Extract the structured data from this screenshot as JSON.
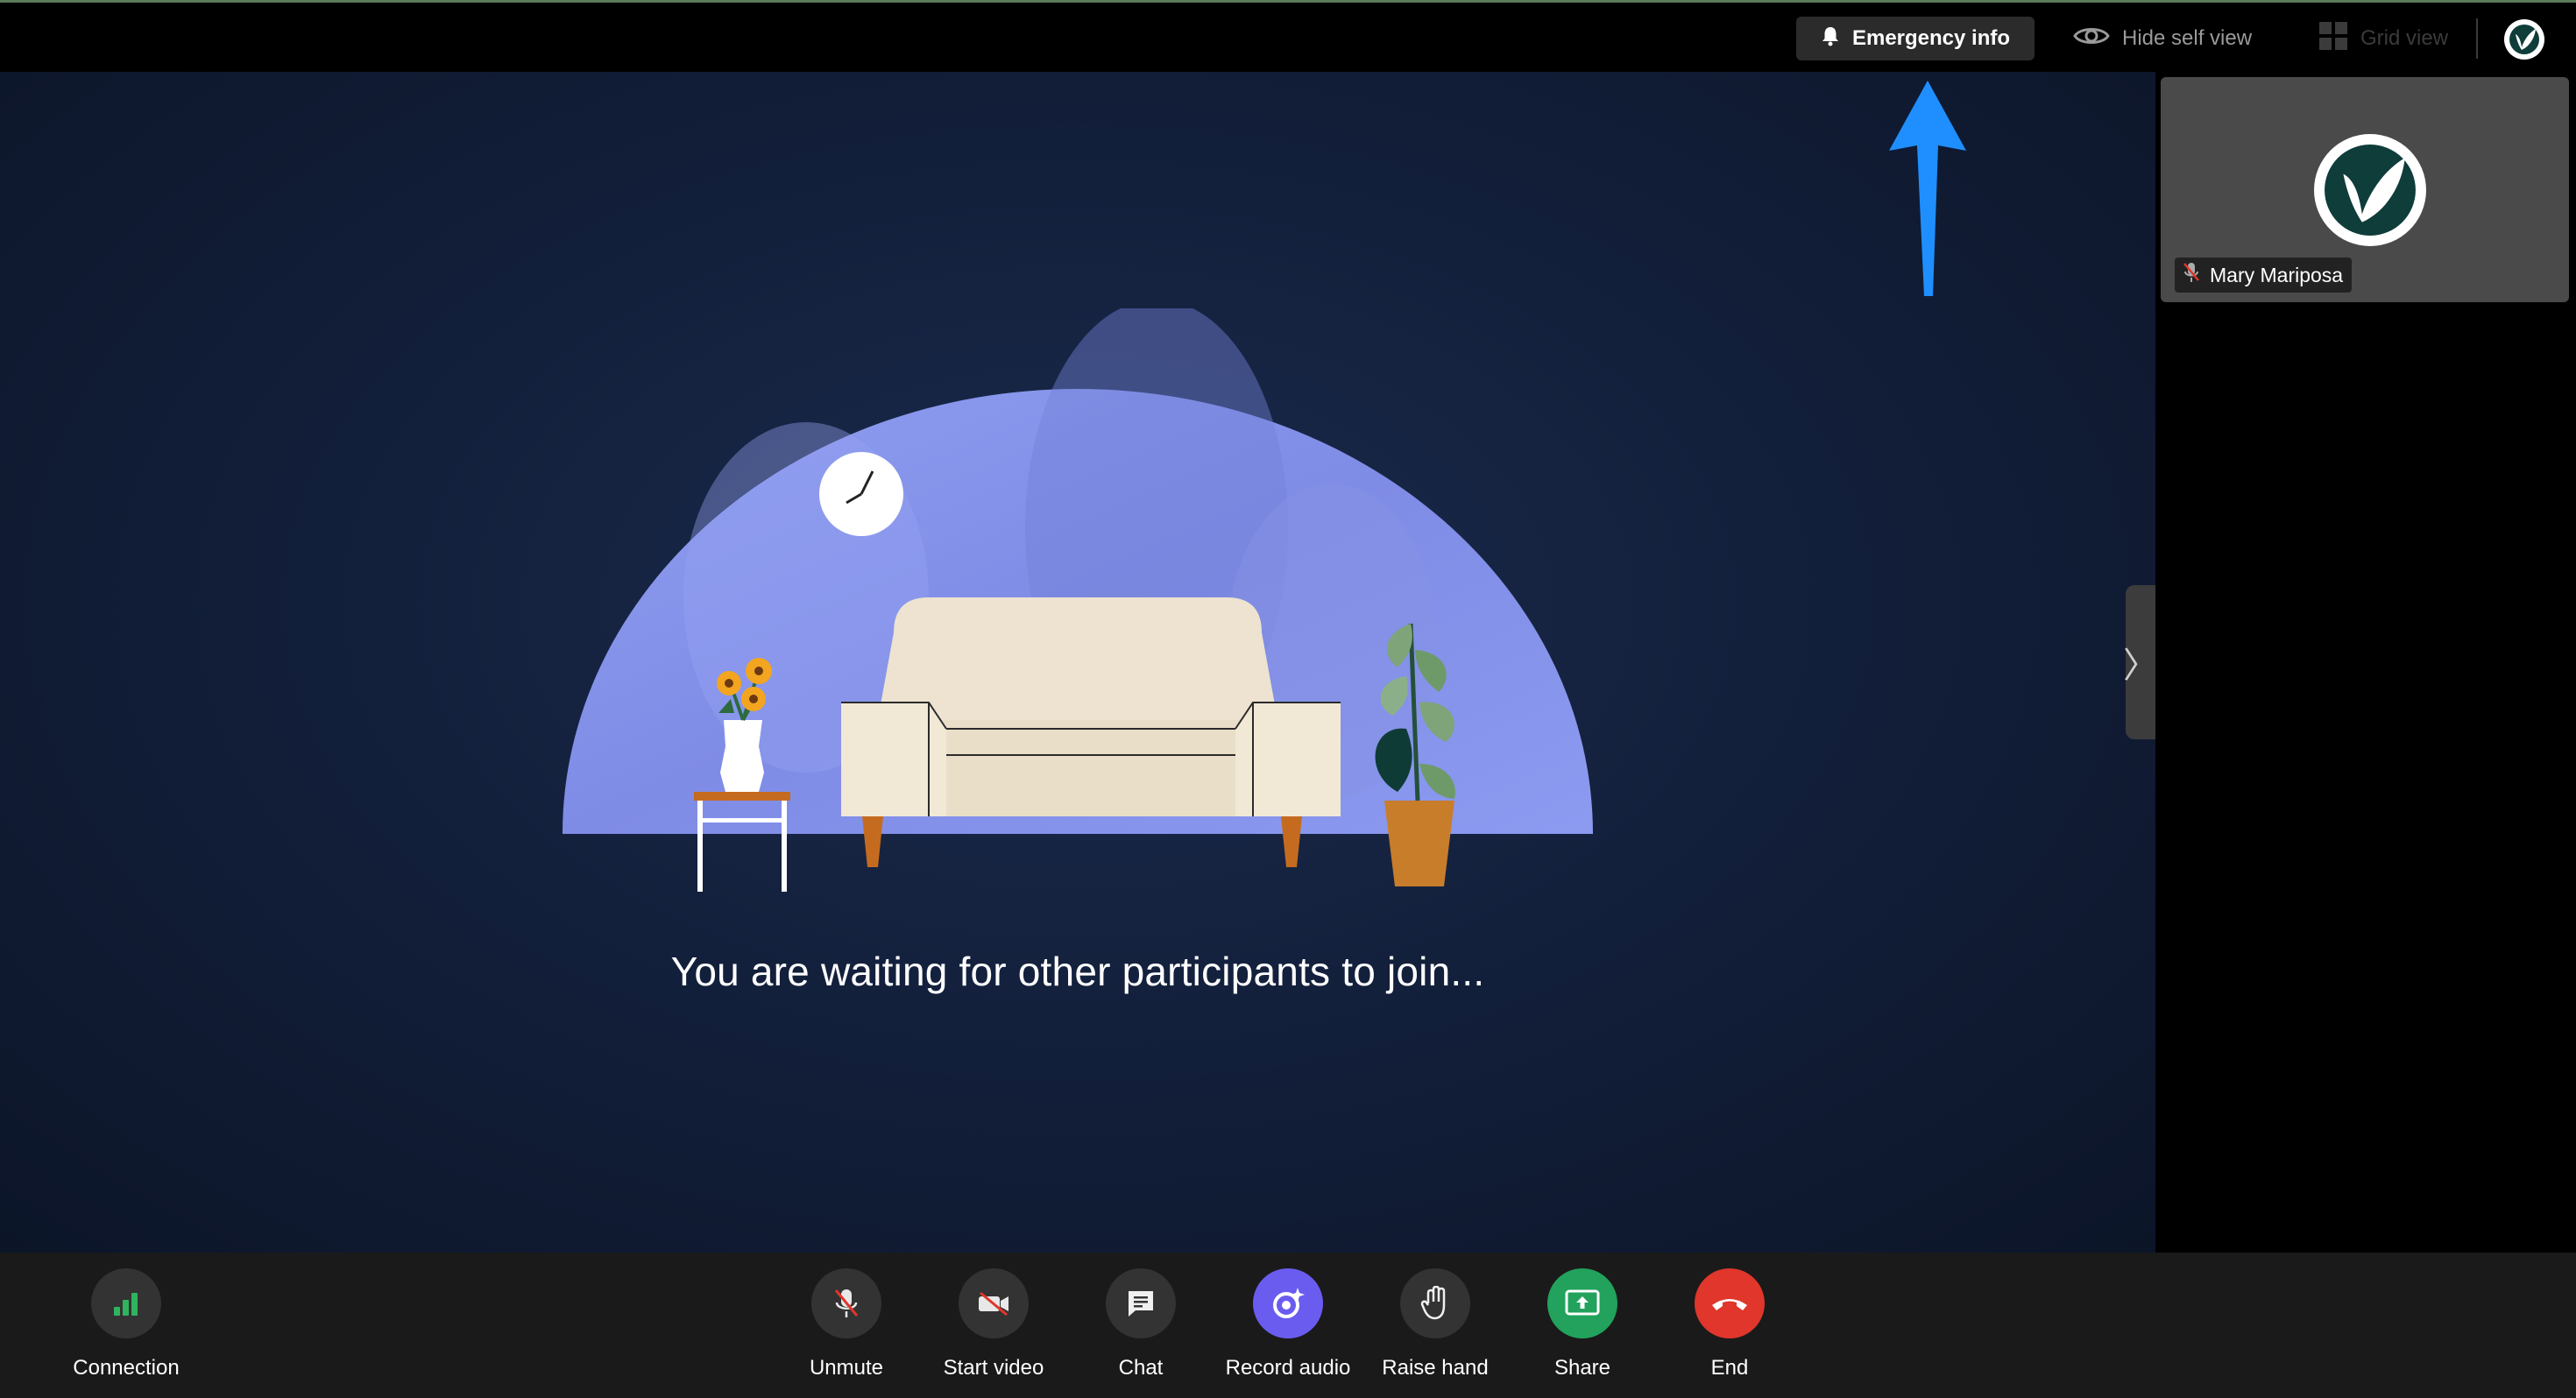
{
  "topbar": {
    "emergency_label": "Emergency info",
    "hide_self_label": "Hide self view",
    "grid_view_label": "Grid view"
  },
  "stage": {
    "waiting_message": "You are waiting for other participants to join..."
  },
  "self_view": {
    "participant_name": "Mary Mariposa",
    "mic_status": "muted"
  },
  "controls": {
    "connection": "Connection",
    "unmute": "Unmute",
    "start_video": "Start video",
    "chat": "Chat",
    "record_audio": "Record audio",
    "raise_hand": "Raise hand",
    "share": "Share",
    "end": "End"
  },
  "colors": {
    "connection_icon": "#2fb35f",
    "record_audio": "#6b5cf0",
    "share": "#22a25c",
    "end": "#e0362c",
    "annotation_arrow": "#1f8fff"
  },
  "icons": {
    "emergency": "bell-icon",
    "hide_self": "eye-icon",
    "grid_view": "grid-icon",
    "connection": "signal-bars-icon",
    "unmute": "mic-off-icon",
    "start_video": "video-off-icon",
    "chat": "chat-bubble-icon",
    "record_audio": "record-sparkle-icon",
    "raise_hand": "hand-icon",
    "share": "share-screen-icon",
    "end": "phone-hangup-icon"
  }
}
